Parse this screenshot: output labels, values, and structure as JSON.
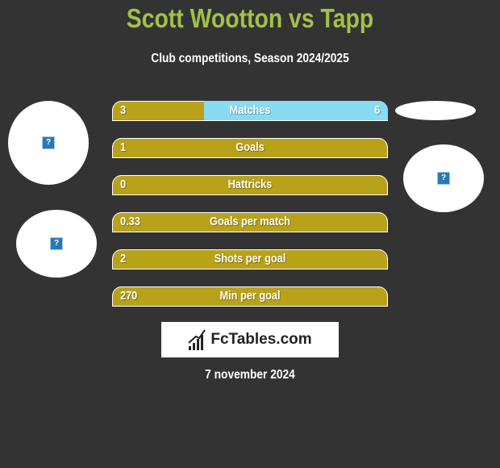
{
  "header": {
    "title": "Scott Wootton vs Tapp",
    "subtitle": "Club competitions, Season 2024/2025"
  },
  "avatars": {
    "left_top_icon": "?",
    "left_bottom_icon": "?",
    "right_icon": "?"
  },
  "colors": {
    "title": "#a3c04a",
    "bar_left": "#b8a21a",
    "bar_right": "#87dcf4",
    "background": "#333333"
  },
  "stats": [
    {
      "label": "Matches",
      "left": "3",
      "right": "6",
      "left_share": 0.3333
    },
    {
      "label": "Goals",
      "left": "1",
      "right": "",
      "left_share": 1.0
    },
    {
      "label": "Hattricks",
      "left": "0",
      "right": "",
      "left_share": 1.0
    },
    {
      "label": "Goals per match",
      "left": "0.33",
      "right": "",
      "left_share": 1.0
    },
    {
      "label": "Shots per goal",
      "left": "2",
      "right": "",
      "left_share": 1.0
    },
    {
      "label": "Min per goal",
      "left": "270",
      "right": "",
      "left_share": 1.0
    }
  ],
  "logo": {
    "text": "FcTables.com"
  },
  "footer": {
    "date": "7 november 2024"
  }
}
